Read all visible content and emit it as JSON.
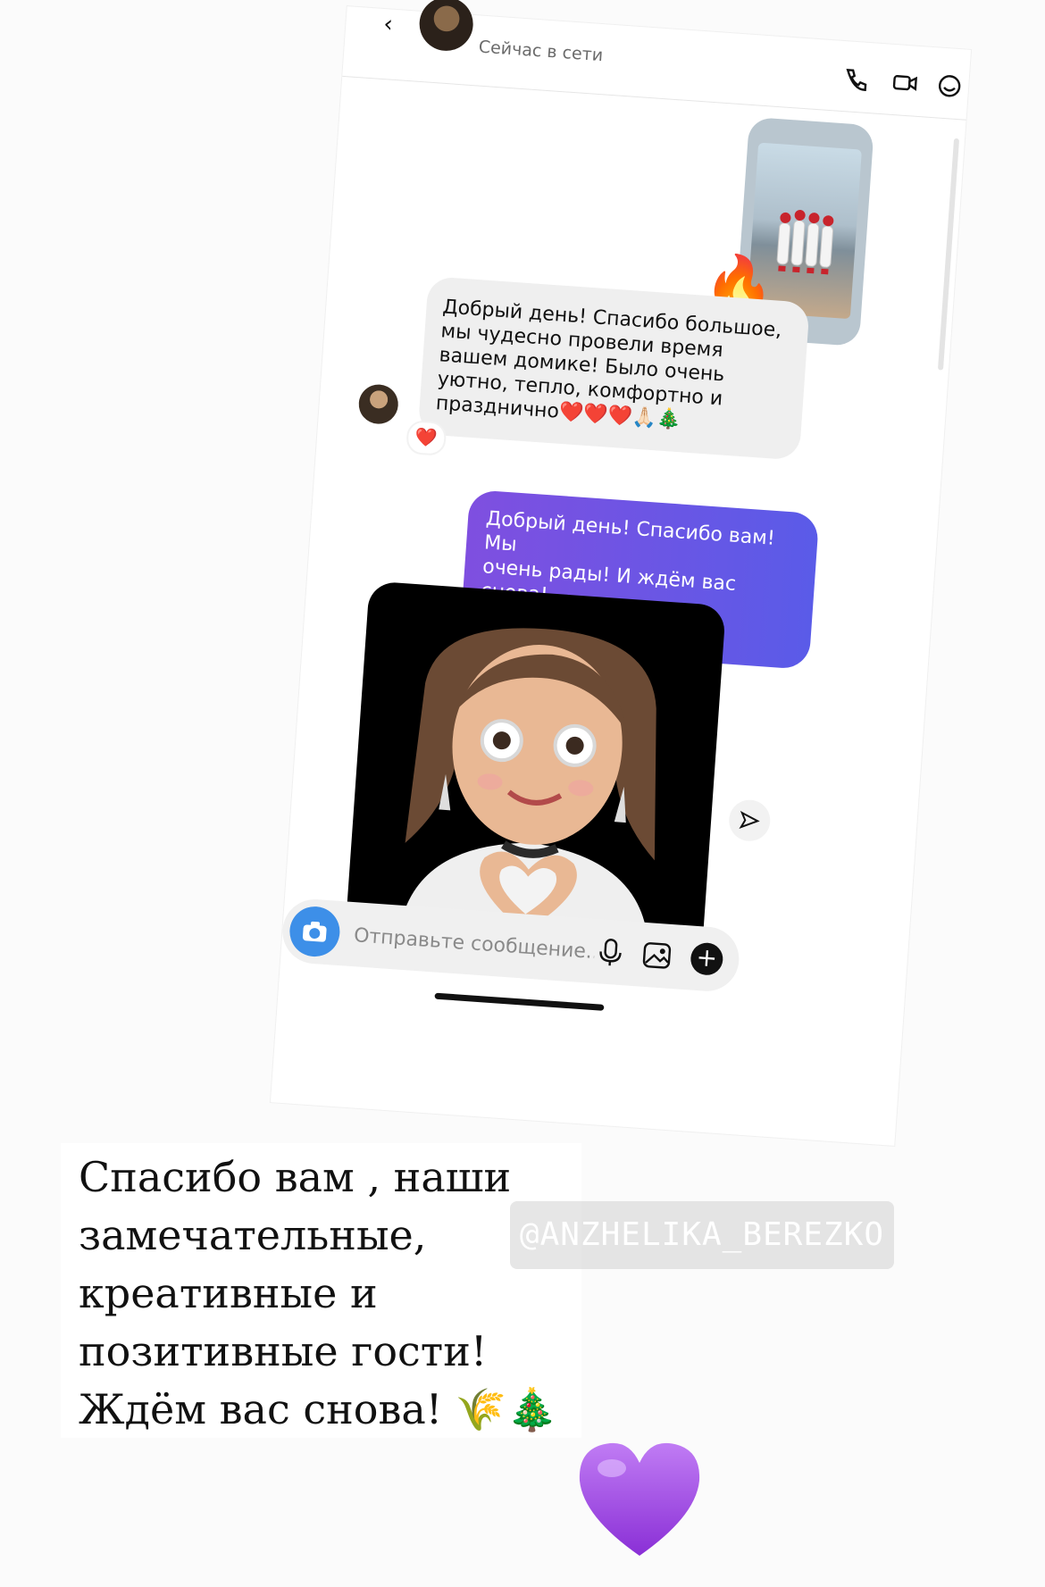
{
  "chat": {
    "header": {
      "back": "‹",
      "status": "Сейчас в сети"
    },
    "story_reaction": "🔥",
    "incoming_message": "Добрый день! Спасибо большое,\nмы чудесно провели время\nвашем домике! Было очень\nуютно, тепло, комфортно и\nпразднично❤️❤️❤️🙏🏻🎄",
    "incoming_reaction": "❤️",
    "outgoing_message": "Добрый день! Спасибо вам! Мы\nочень рады! И ждём вас снова!\n🌾💜",
    "composer": {
      "placeholder": "Отправьте сообщение...",
      "plus": "+"
    }
  },
  "caption": "Спасибо вам , наши\nзамечательные,\nкреативные и\nпозитивные гости!\nЖдём вас снова! 🌾🎄",
  "mention": "@ANZHELIKA_BEREZKO",
  "colors": {
    "outgoing_gradient_start": "#7f4fe0",
    "outgoing_gradient_end": "#5a5be8",
    "camera_button": "#3d8fe8",
    "heart": "#a44ee6"
  }
}
